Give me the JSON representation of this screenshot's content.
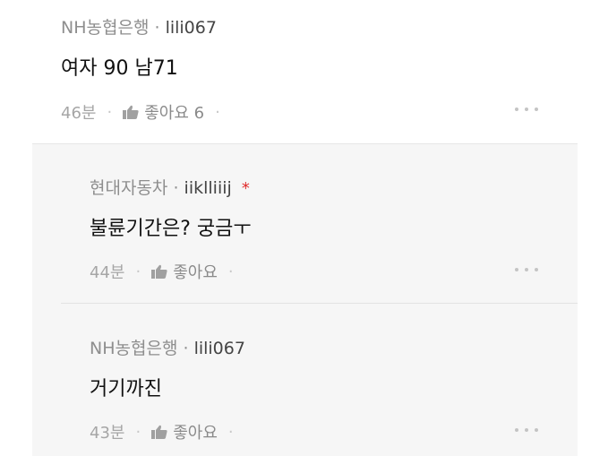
{
  "comments": [
    {
      "bank": "NH농협은행",
      "separator": "·",
      "user": "lili067",
      "text": "여자 90 남71",
      "time": "46분",
      "like_label": "좋아요 6"
    },
    {
      "bank": "현대자동차",
      "separator": "·",
      "user": "iiklliiij",
      "badge": "*",
      "text": "불륜기간은? 궁금ㅜ",
      "time": "44분",
      "like_label": "좋아요"
    },
    {
      "bank": "NH농협은행",
      "separator": "·",
      "user": "lili067",
      "text": "거기까진",
      "time": "43분",
      "like_label": "좋아요"
    }
  ],
  "icons": {
    "like": "thumbs-up-icon",
    "more": "more-options-icon"
  },
  "colors": {
    "reply_background": "#f6f6f6",
    "badge": "#e02b2b"
  }
}
